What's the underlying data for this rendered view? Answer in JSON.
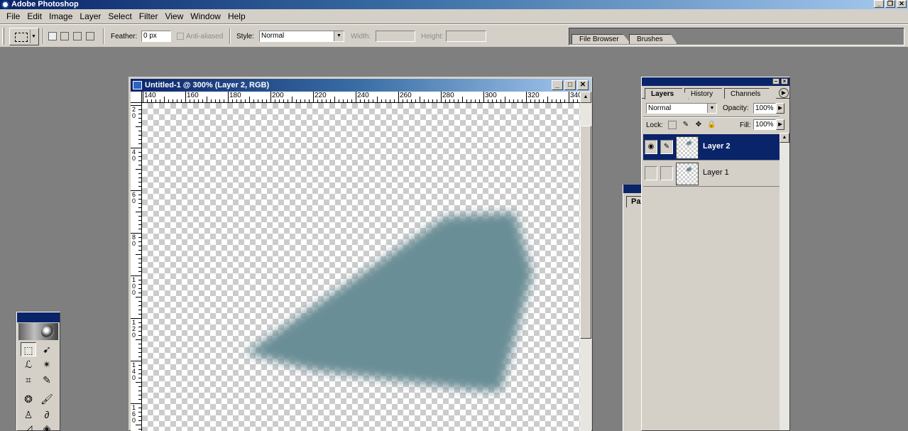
{
  "app": {
    "title": "Adobe Photoshop",
    "window_controls": [
      "_",
      "❐",
      "✕"
    ]
  },
  "menu": [
    "File",
    "Edit",
    "Image",
    "Layer",
    "Select",
    "Filter",
    "View",
    "Window",
    "Help"
  ],
  "options": {
    "feather_label": "Feather:",
    "feather_value": "0 px",
    "anti_aliased_label": "Anti-aliased",
    "style_label": "Style:",
    "style_value": "Normal",
    "width_label": "Width:",
    "height_label": "Height:"
  },
  "palette_well": {
    "tabs": [
      "File Browser",
      "Brushes"
    ]
  },
  "document": {
    "title": "Untitled-1 @ 300% (Layer 2, RGB)",
    "controls": [
      "_",
      "□",
      "✕"
    ],
    "h_ruler_labels": [
      "140",
      "160",
      "180",
      "200",
      "220",
      "240",
      "260",
      "280",
      "300",
      "320",
      "340"
    ],
    "v_ruler_labels": [
      "20",
      "40",
      "60",
      "80",
      "100",
      "120",
      "140",
      "160"
    ],
    "shape_color": "#6a8e96"
  },
  "toolbox": {
    "tools": [
      "marquee-icon",
      "move-icon",
      "lasso-icon",
      "magic-wand-icon",
      "crop-icon",
      "slice-icon",
      "healing-icon",
      "brush-icon",
      "stamp-icon",
      "history-brush-icon",
      "eraser-icon",
      "gradient-icon"
    ]
  },
  "paths_panel": {
    "tab_label": "Pa"
  },
  "layers_panel": {
    "tabs": [
      "Layers",
      "History",
      "Channels"
    ],
    "blend_mode": "Normal",
    "opacity_label": "Opacity:",
    "opacity_value": "100%",
    "lock_label": "Lock:",
    "fill_label": "Fill:",
    "fill_value": "100%",
    "layers": [
      {
        "name": "Layer 2",
        "selected": true,
        "visible": true
      },
      {
        "name": "Layer 1",
        "selected": false,
        "visible": false
      }
    ]
  },
  "colors": {
    "title_active": "#0a246a",
    "chrome": "#d4d0c8",
    "workspace": "#7f7f7f"
  }
}
